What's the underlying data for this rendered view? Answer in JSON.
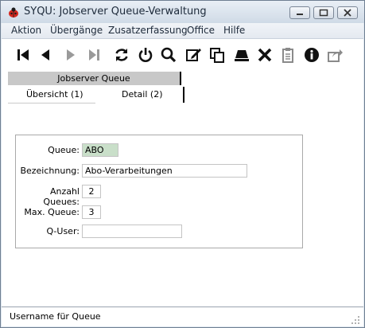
{
  "window": {
    "title": "SYQU: Jobserver Queue-Verwaltung"
  },
  "menu": [
    "Aktion",
    "Übergänge",
    "Zusatzerfassung",
    "Office",
    "Hilfe"
  ],
  "toolbar": {
    "icons": [
      "first-icon",
      "prev-icon",
      "next-icon",
      "last-icon",
      "refresh-icon",
      "power-icon",
      "search-icon",
      "edit-icon",
      "copy-icon",
      "save-icon",
      "delete-icon",
      "clipboard-icon",
      "info-icon",
      "share-icon"
    ]
  },
  "tabs": {
    "group": "Jobserver Queue",
    "tab1": "Übersicht (1)",
    "tab2": "Detail (2)"
  },
  "form": {
    "queue_label": "Queue:",
    "queue_value": "ABO",
    "bezeichnung_label": "Bezeichnung:",
    "bezeichnung_value": "Abo-Verarbeitungen",
    "anzahl_label": "Anzahl Queues:",
    "anzahl_value": "2",
    "max_label": "Max. Queue:",
    "max_value": "3",
    "quser_label": "Q-User:",
    "quser_value": ""
  },
  "status": {
    "text": "Username für Queue"
  },
  "colors": {
    "field_highlight": "#c9dfc9",
    "titlebar": "#dfe7f0"
  }
}
